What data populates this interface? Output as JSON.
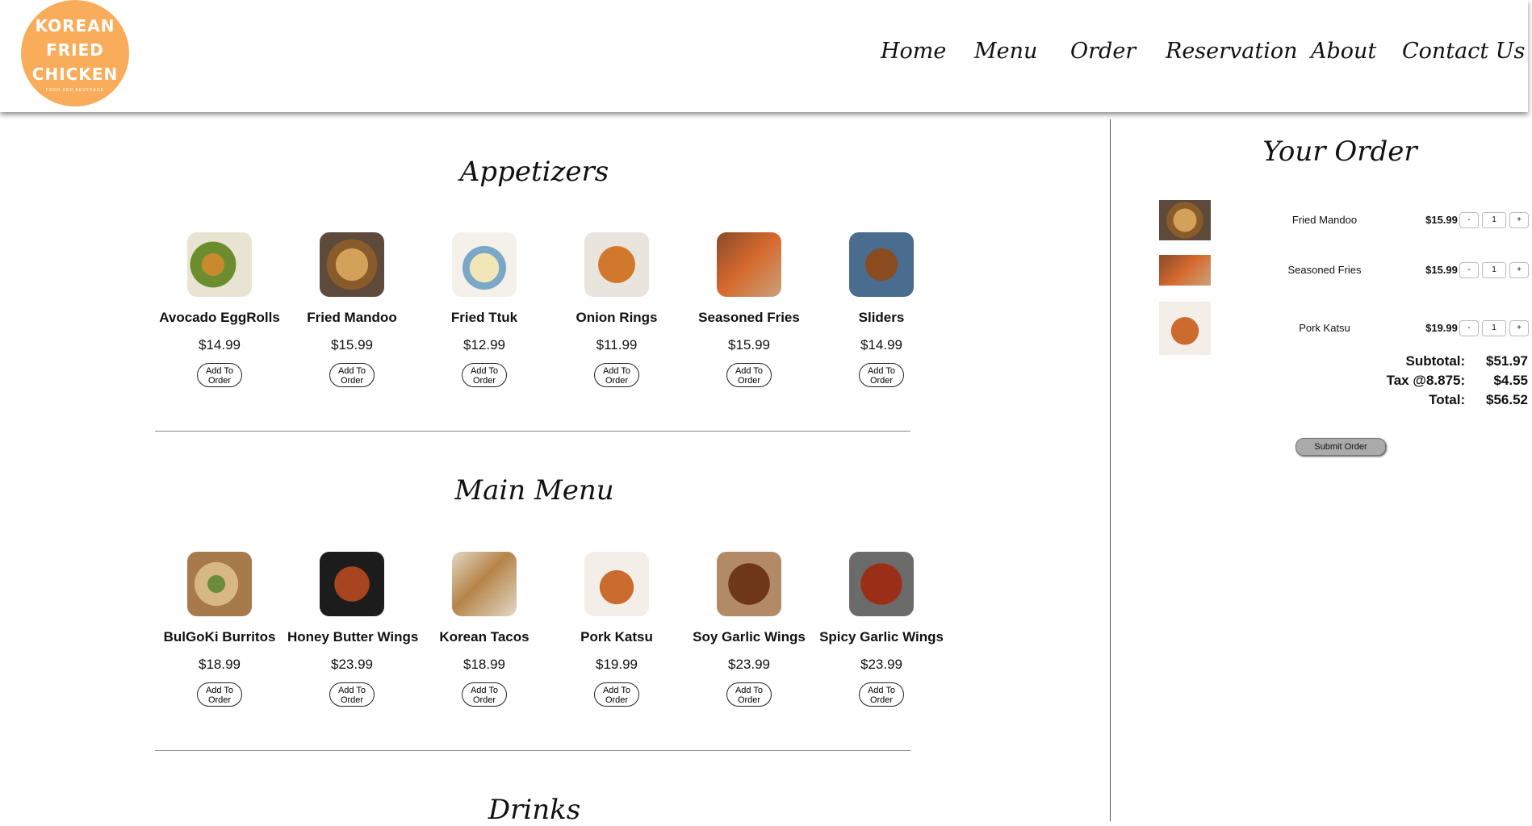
{
  "brand": {
    "logo_line1": "KOREAN",
    "logo_line2": "FRIED",
    "logo_line3": "CHICKEN",
    "logo_sub": "FOOD AND BEVERAGE",
    "color": "#f9ad5a"
  },
  "nav": [
    "Home",
    "Menu",
    "Order",
    "Reservation",
    "About",
    "Contact Us"
  ],
  "sections": [
    {
      "title": "Appetizers",
      "items": [
        {
          "name": "Avocado EggRolls",
          "price": "$14.99",
          "button": "Add To Order",
          "img": "egg-rolls-photo"
        },
        {
          "name": "Fried Mandoo",
          "price": "$15.99",
          "button": "Add To Order",
          "img": "dumplings-photo"
        },
        {
          "name": "Fried Ttuk",
          "price": "$12.99",
          "button": "Add To Order",
          "img": "rice-cake-photo"
        },
        {
          "name": "Onion Rings",
          "price": "$11.99",
          "button": "Add To Order",
          "img": "onion-rings-photo"
        },
        {
          "name": "Seasoned Fries",
          "price": "$15.99",
          "button": "Add To Order",
          "img": "fries-photo"
        },
        {
          "name": "Sliders",
          "price": "$14.99",
          "button": "Add To Order",
          "img": "sliders-photo"
        }
      ]
    },
    {
      "title": "Main Menu",
      "items": [
        {
          "name": "BulGoKi Burritos",
          "price": "$18.99",
          "button": "Add To Order",
          "img": "burrito-photo"
        },
        {
          "name": "Honey Butter Wings",
          "price": "$23.99",
          "button": "Add To Order",
          "img": "honey-wings-photo"
        },
        {
          "name": "Korean Tacos",
          "price": "$18.99",
          "button": "Add To Order",
          "img": "tacos-photo"
        },
        {
          "name": "Pork Katsu",
          "price": "$19.99",
          "button": "Add To Order",
          "img": "katsu-photo"
        },
        {
          "name": "Soy Garlic Wings",
          "price": "$23.99",
          "button": "Add To Order",
          "img": "soy-wings-photo"
        },
        {
          "name": "Spicy Garlic Wings",
          "price": "$23.99",
          "button": "Add To Order",
          "img": "spicy-wings-photo"
        }
      ]
    },
    {
      "title": "Drinks",
      "items": []
    }
  ],
  "order": {
    "title": "Your Order",
    "items": [
      {
        "name": "Fried Mandoo",
        "price": "$15.99",
        "qty": "1",
        "minus": "-",
        "plus": "+"
      },
      {
        "name": "Seasoned Fries",
        "price": "$15.99",
        "qty": "1",
        "minus": "-",
        "plus": "+"
      },
      {
        "name": "Pork Katsu",
        "price": "$19.99",
        "qty": "1",
        "minus": "-",
        "plus": "+"
      }
    ],
    "subtotal_label": "Subtotal:",
    "subtotal": "$51.97",
    "tax_label": "Tax @8.875:",
    "tax": "$4.55",
    "total_label": "Total:",
    "total": "$56.52",
    "submit": "Submit Order"
  }
}
